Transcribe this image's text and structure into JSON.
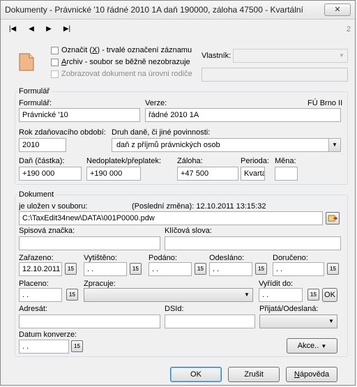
{
  "window": {
    "title": "Dokumenty - Právnické '10 řádné 2010 1A daň 190000, záloha 47500 - Kvartální",
    "close_icon": "close-icon"
  },
  "nav": {
    "first": "|◀",
    "prev": "◀",
    "next": "▶",
    "last": "▶|",
    "page": "2"
  },
  "top": {
    "oznacit_a": "Označit (",
    "oznacit_key": "X",
    "oznacit_b": ") - trvalé označení záznamu",
    "archiv_key": "A",
    "archiv_rest": "rchiv - soubor se běžně nezobrazuje",
    "zobrazovat": "Zobrazovat dokument na úrovni rodiče",
    "vlastnik_label": "Vlastník:",
    "vlastnik_value": ""
  },
  "formular": {
    "group_title": "Formulář",
    "formular_label": "Formulář:",
    "formular_value": "Právnické '10",
    "verze_label": "Verze:",
    "verze_value": "řádné 2010 1A",
    "fu": "FÚ Brno II",
    "rok_label": "Rok zdaňovacího období:",
    "rok_value": "2010",
    "druh_label": "Druh daně, či jiné povinnosti:",
    "druh_value": "daň z příjmů právnických osob",
    "dan_label": "Daň (částka):",
    "dan_value": "+190 000",
    "nedoplatek_label": "Nedoplatek/přeplatek:",
    "nedoplatek_value": "+190 000",
    "zaloha_label": "Záloha:",
    "zaloha_value": "+47 500",
    "perioda_label": "Perioda:",
    "perioda_value": "Kvarta",
    "mena_label": "Měna:",
    "mena_value": ""
  },
  "dokument": {
    "group_title": "Dokument",
    "ulozen_label": "je uložen v souboru:",
    "posledni_label": "(Poslední změna):",
    "posledni_value": "12.10.2011 13:15:32",
    "soubor_value": "C:\\TaxEdit34new\\DATA\\001P0000.pdw",
    "spisova_label": "Spisová značka:",
    "spisova_value": "",
    "klicova_label": "Klíčová slova:",
    "klicova_value": "",
    "zarazeno_label": "Zařazeno:",
    "zarazeno_value": "12.10.2011",
    "vytisteno_label": "Vytištěno:",
    "vytisteno_value": " .  .",
    "podano_label": "Podáno:",
    "podano_value": " .  .",
    "odeslano_label": "Odesláno:",
    "odeslano_value": " .  .",
    "doruceno_label": "Doručeno:",
    "doruceno_value": " .  .",
    "placeno_label": "Placeno:",
    "placeno_value": " .  .",
    "zpracuje_label": "Zpracuje:",
    "zpracuje_value": "",
    "vyridit_label": "Vyřídit do:",
    "vyridit_value": " .  .",
    "ok_small": "OK",
    "adresat_label": "Adresát:",
    "adresat_value": "",
    "dsid_label": "DSId:",
    "dsid_value": "",
    "prijata_label": "Přijatá/Odeslaná:",
    "prijata_value": "",
    "datum_label": "Datum konverze:",
    "datum_value": " .  .",
    "akce_label": "Akce..",
    "cal_glyph": "15"
  },
  "buttons": {
    "ok": "OK",
    "zrusit": "Zrušit",
    "napoveda_key": "N",
    "napoveda_rest": "ápověda"
  }
}
